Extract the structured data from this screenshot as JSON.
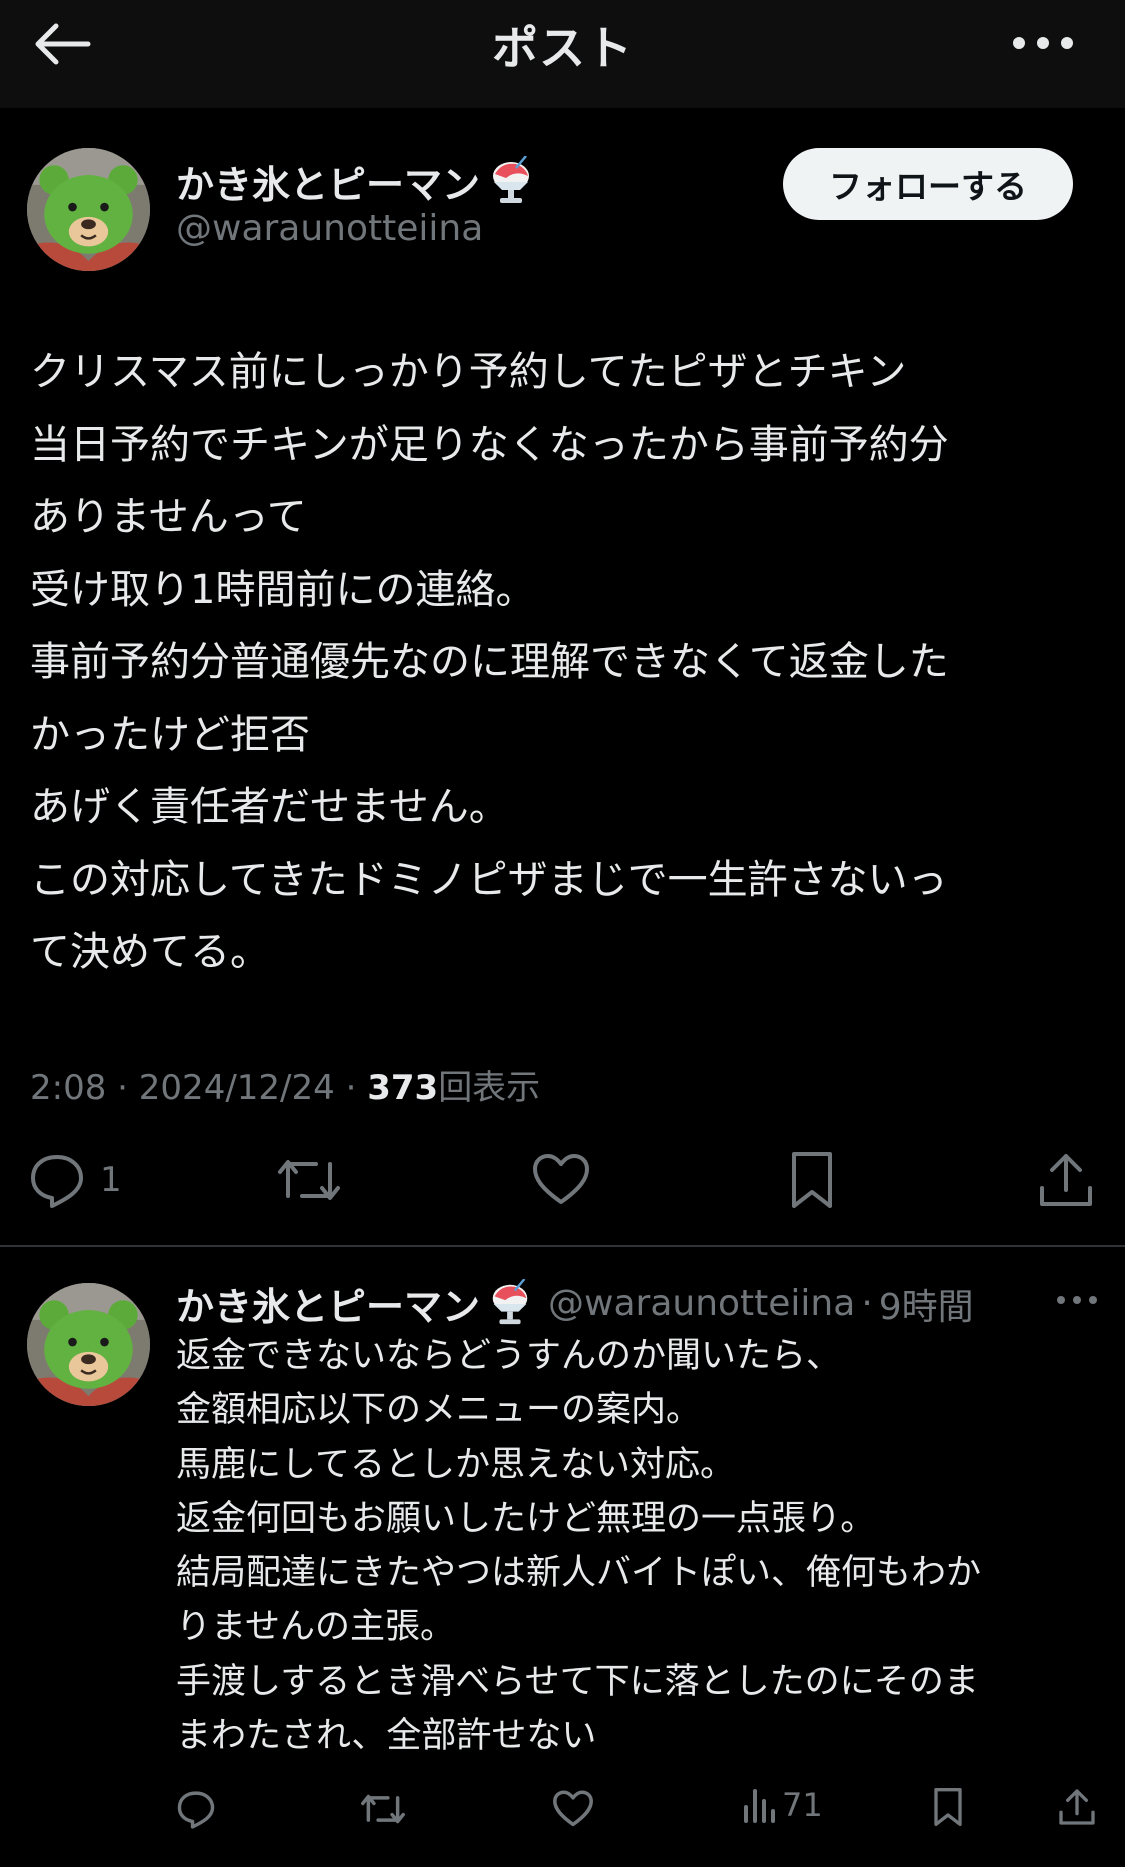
{
  "header": {
    "title": "ポスト",
    "back_icon": "arrow-left-icon",
    "more_icon": "ellipsis-horizontal-icon"
  },
  "post": {
    "author_name": "かき氷とピーマン",
    "author_emoji": "shaved-ice-icon",
    "handle": "@waraunotteiina",
    "follow_label": "フォローする",
    "lines": [
      "クリスマス前にしっかり予約してたピザとチキン",
      "当日予約でチキンが足りなくなったから事前予約分",
      "ありませんって",
      "受け取り1時間前にの連絡。",
      "事前予約分普通優先なのに理解できなくて返金した",
      "かったけど拒否",
      "あげく責任者だせません。",
      "この対応してきたドミノピザまじで一生許さないっ",
      "て決めてる。"
    ],
    "time": "2:08",
    "date": "2024/12/24",
    "views": "373",
    "views_label": "回表示",
    "separator": "·",
    "reply_count": "1",
    "actions": [
      "reply-icon",
      "repost-icon",
      "like-icon",
      "bookmark-icon",
      "share-icon"
    ]
  },
  "reply": {
    "author_name": "かき氷とピーマン",
    "author_emoji": "shaved-ice-icon",
    "handle": "@waraunotteiina",
    "separator": "·",
    "time": "9時間",
    "lines": [
      "返金できないならどうすんのか聞いたら、",
      "金額相応以下のメニューの案内。",
      "馬鹿にしてるとしか思えない対応。",
      "返金何回もお願いしたけど無理の一点張り。",
      "結局配達にきたやつは新人バイトぽい、俺何もわか",
      "りませんの主張。",
      "手渡しするとき滑べらせて下に落としたのにそのま",
      "まわたされ、全部許せない"
    ],
    "views": "71",
    "actions": [
      "reply-icon",
      "repost-icon",
      "like-icon",
      "views-icon",
      "bookmark-icon",
      "share-icon"
    ]
  },
  "colors": {
    "background": "#000000",
    "header_bg": "#0e0e0e",
    "text": "#e7e9ea",
    "muted": "#71767b",
    "divider": "#2f3336",
    "follow_bg": "#eff3f4"
  }
}
